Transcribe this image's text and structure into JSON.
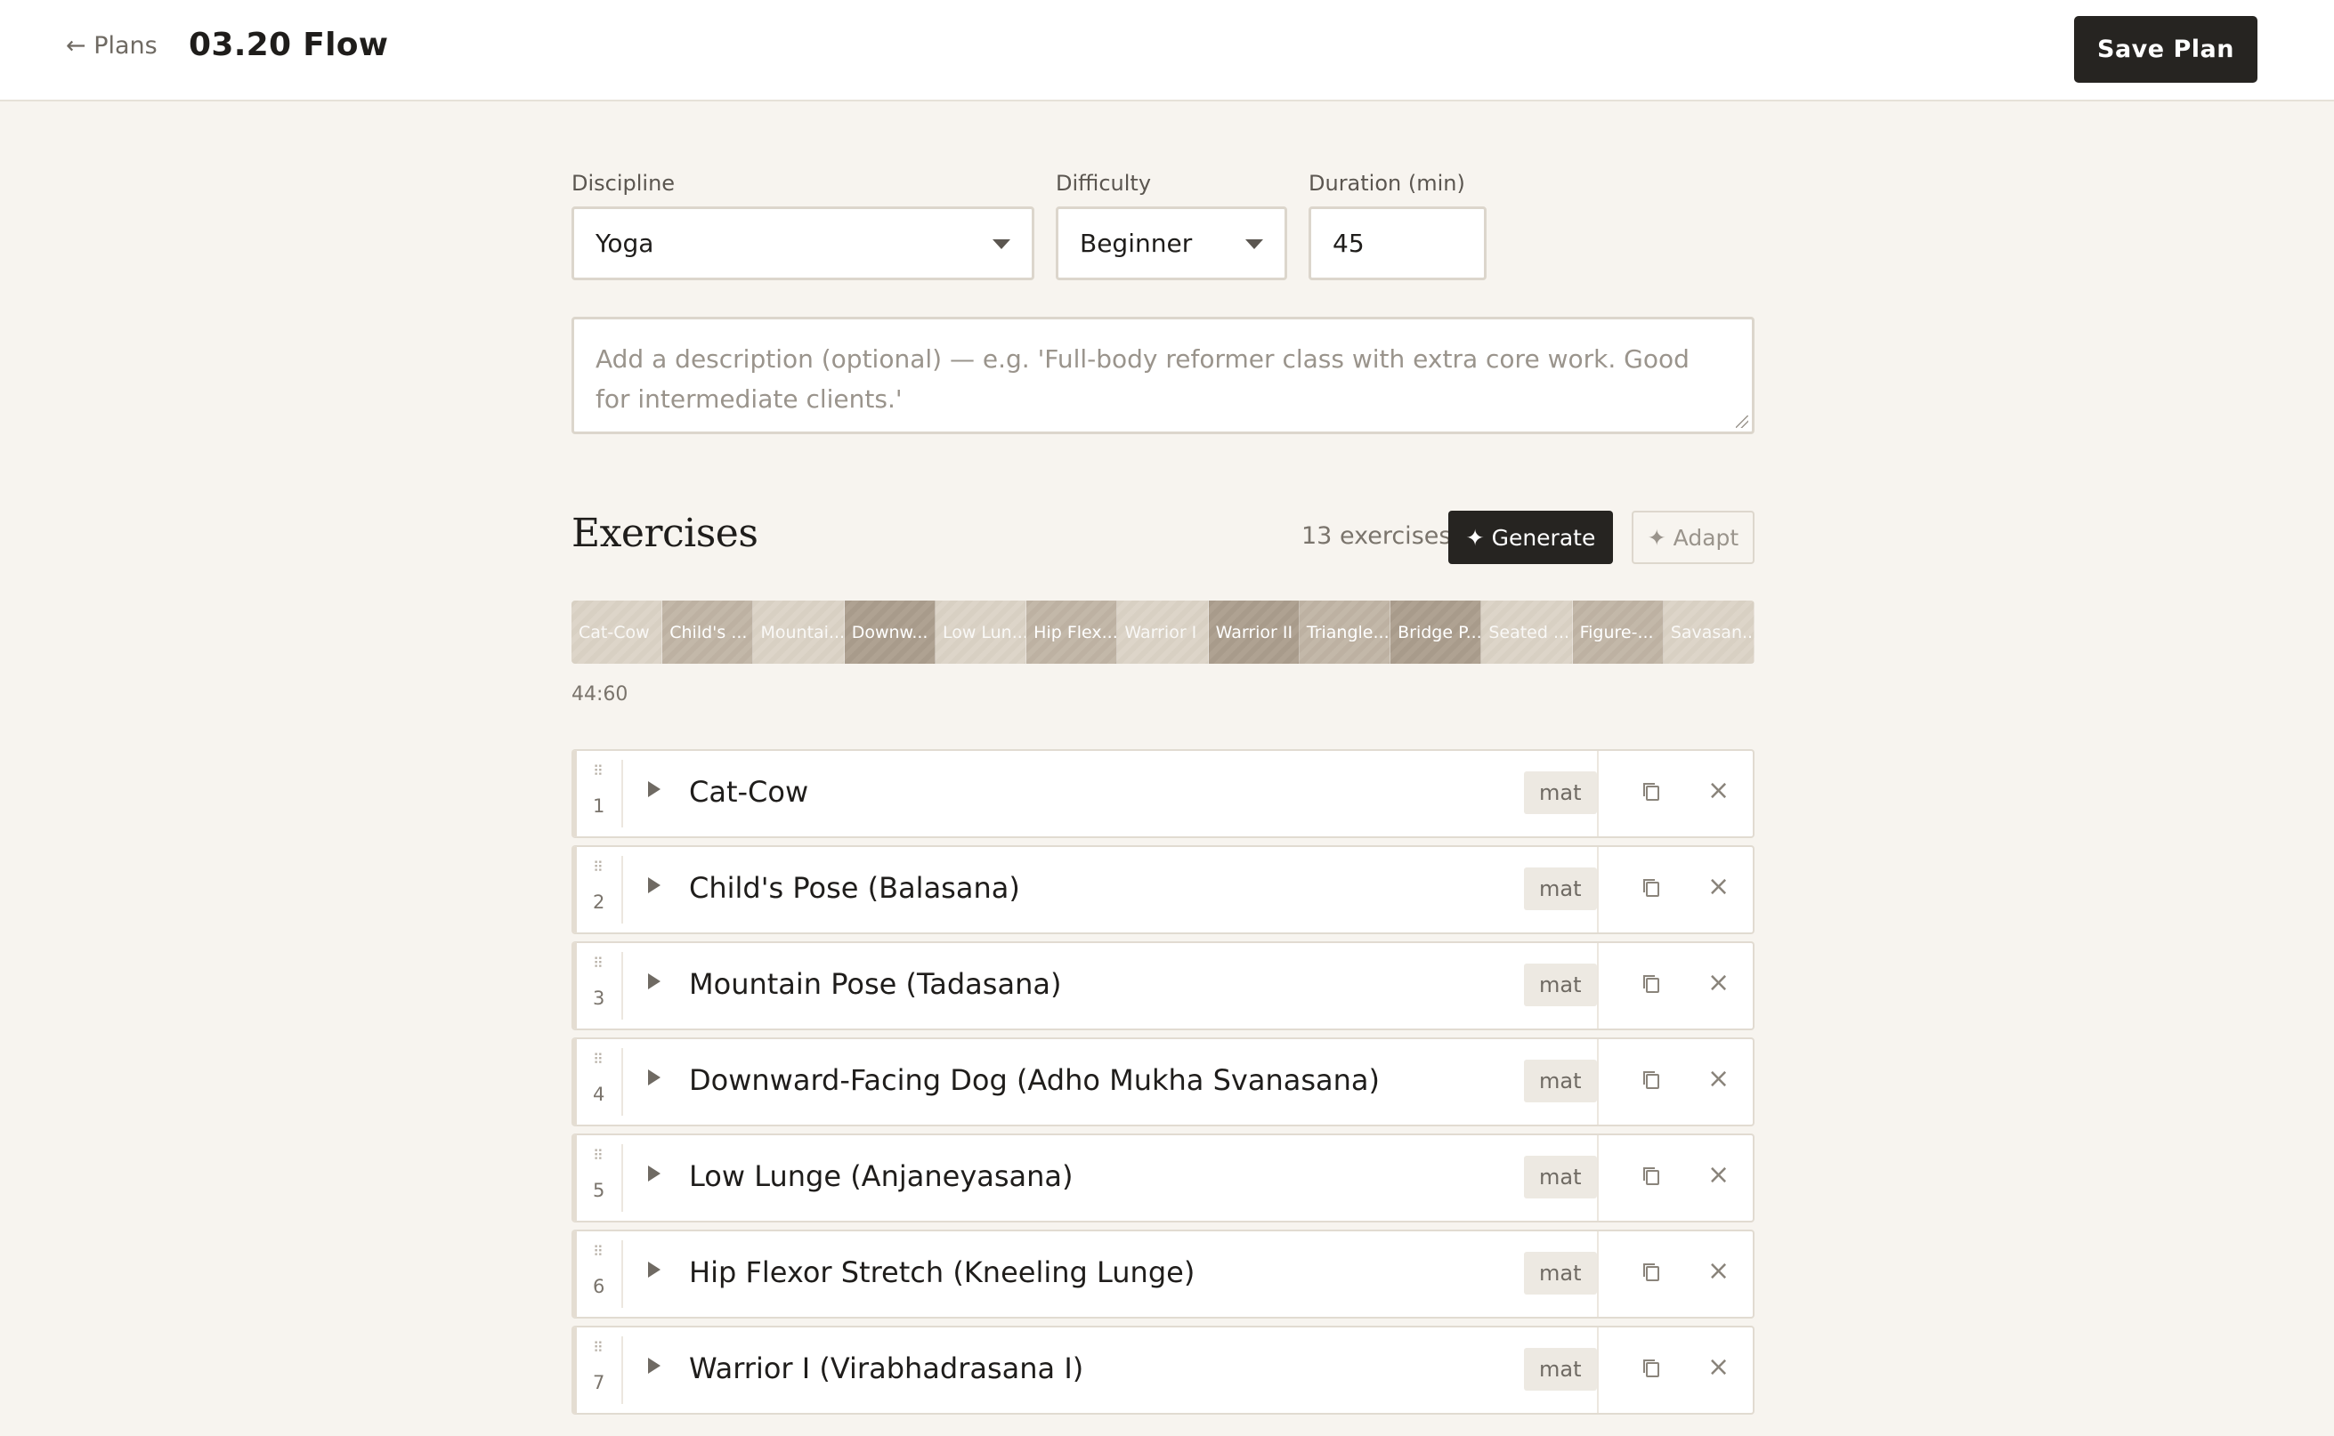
{
  "header": {
    "back_label": "← Plans",
    "title": "03.20 Flow",
    "save_label": "Save Plan"
  },
  "form": {
    "discipline_label": "Discipline",
    "discipline_value": "Yoga",
    "difficulty_label": "Difficulty",
    "difficulty_value": "Beginner",
    "duration_label": "Duration (min)",
    "duration_value": "45",
    "description_placeholder": "Add a description (optional) — e.g. 'Full-body reformer class with extra core work. Good for intermediate clients.'"
  },
  "exercises": {
    "title": "Exercises",
    "count_label": "13 exercises",
    "generate_label": "✦ Generate",
    "adapt_label": "✦ Adapt",
    "timecode": "44:60",
    "timeline": [
      {
        "label": "Cat-Cow",
        "shade": "light"
      },
      {
        "label": "Child's ...",
        "shade": "mid"
      },
      {
        "label": "Mountai...",
        "shade": "light"
      },
      {
        "label": "Downw...",
        "shade": "dark"
      },
      {
        "label": "Low Lun...",
        "shade": "light"
      },
      {
        "label": "Hip Flex...",
        "shade": "mid"
      },
      {
        "label": "Warrior I",
        "shade": "light"
      },
      {
        "label": "Warrior II",
        "shade": "dark"
      },
      {
        "label": "Triangle...",
        "shade": "mid"
      },
      {
        "label": "Bridge P...",
        "shade": "dark"
      },
      {
        "label": "Seated ...",
        "shade": "light"
      },
      {
        "label": "Figure-...",
        "shade": "mid"
      },
      {
        "label": "Savasan...",
        "shade": "light"
      }
    ],
    "items": [
      {
        "num": "1",
        "name": "Cat-Cow",
        "tag": "mat"
      },
      {
        "num": "2",
        "name": "Child's Pose (Balasana)",
        "tag": "mat"
      },
      {
        "num": "3",
        "name": "Mountain Pose (Tadasana)",
        "tag": "mat"
      },
      {
        "num": "4",
        "name": "Downward-Facing Dog (Adho Mukha Svanasana)",
        "tag": "mat"
      },
      {
        "num": "5",
        "name": "Low Lunge (Anjaneyasana)",
        "tag": "mat"
      },
      {
        "num": "6",
        "name": "Hip Flexor Stretch (Kneeling Lunge)",
        "tag": "mat"
      },
      {
        "num": "7",
        "name": "Warrior I (Virabhadrasana I)",
        "tag": "mat"
      }
    ]
  }
}
